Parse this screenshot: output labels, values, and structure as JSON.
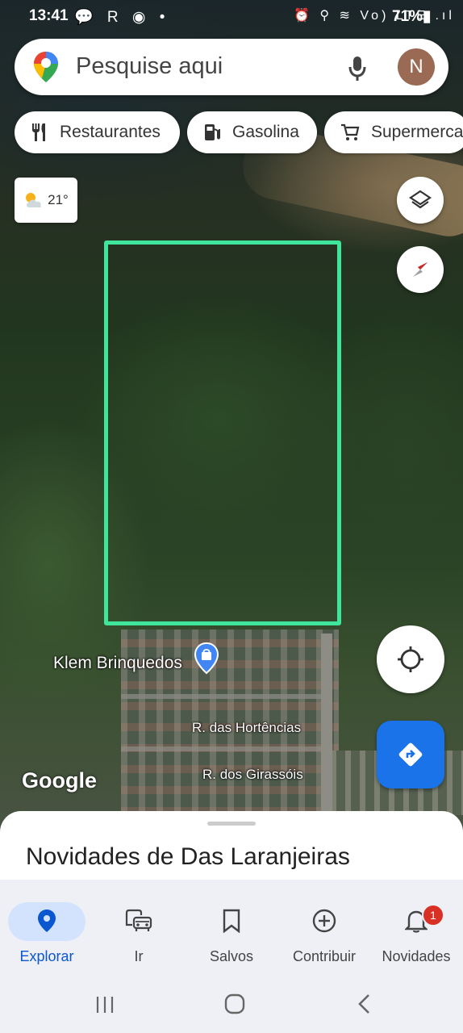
{
  "status_bar": {
    "time": "13:41",
    "left_icons": "💬 R ◉ •",
    "right_icons": "⏰ ⚲ ≋ Vo) LTE .ıl",
    "battery": "71%▮"
  },
  "search": {
    "placeholder": "Pesquise aqui",
    "avatar_letter": "N"
  },
  "chips": [
    {
      "label": "Restaurantes",
      "icon": "fork-knife-icon"
    },
    {
      "label": "Gasolina",
      "icon": "gas-pump-icon"
    },
    {
      "label": "Supermerca",
      "icon": "shopping-cart-icon"
    }
  ],
  "weather": {
    "temperature": "21°",
    "icon": "partly-cloudy-icon"
  },
  "map": {
    "place_label": "Klem Brinquedos",
    "street_1": "R. das Hortências",
    "street_2": "R. dos Girassóis",
    "google_logo": "Google",
    "boundary_color": "#3ee59a"
  },
  "sheet": {
    "title": "Novidades de Das Laranjeiras"
  },
  "nav": {
    "items": [
      {
        "label": "Explorar",
        "icon": "location-pin-icon",
        "active": true
      },
      {
        "label": "Ir",
        "icon": "commute-icon"
      },
      {
        "label": "Salvos",
        "icon": "bookmark-icon"
      },
      {
        "label": "Contribuir",
        "icon": "add-circle-icon"
      },
      {
        "label": "Novidades",
        "icon": "bell-icon",
        "badge": "1"
      }
    ]
  },
  "colors": {
    "accent": "#1a73e8",
    "active_pill": "#d3e3fd",
    "badge": "#d93025"
  }
}
